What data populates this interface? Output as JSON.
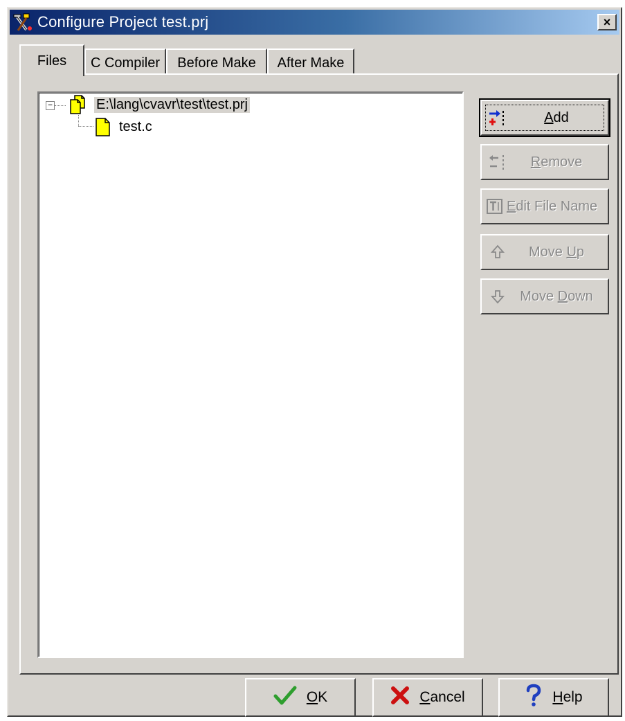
{
  "window": {
    "title": "Configure Project test.prj",
    "close_label": "×"
  },
  "tabs": [
    {
      "label": "Files",
      "active": true
    },
    {
      "label": "C Compiler",
      "active": false
    },
    {
      "label": "Before Make",
      "active": false
    },
    {
      "label": "After Make",
      "active": false
    }
  ],
  "tree": {
    "expand_symbol": "−",
    "root": {
      "label": "E:\\lang\\cvavr\\test\\test.prj",
      "expanded": true,
      "selected": true
    },
    "children": [
      {
        "label": "test.c"
      }
    ]
  },
  "side_buttons": {
    "add": {
      "mnemonic": "A",
      "rest": "dd",
      "enabled": true
    },
    "remove": {
      "mnemonic": "R",
      "rest": "emove",
      "enabled": false
    },
    "edit": {
      "pre": "",
      "mnemonic": "E",
      "rest": "dit File Name",
      "enabled": false
    },
    "move_up": {
      "pre": "Move ",
      "mnemonic": "U",
      "rest": "p",
      "enabled": false
    },
    "move_down": {
      "pre": "Move ",
      "mnemonic": "D",
      "rest": "own",
      "enabled": false
    }
  },
  "bottom_buttons": {
    "ok": {
      "mnemonic": "O",
      "rest": "K"
    },
    "cancel": {
      "mnemonic": "C",
      "rest": "ancel"
    },
    "help": {
      "mnemonic": "H",
      "rest": "elp"
    }
  },
  "colors": {
    "titlebar_start": "#0a246a",
    "titlebar_end": "#a6caf0",
    "face": "#d6d3ce",
    "ok_check": "#2e9e2e",
    "cancel_x": "#cc1010",
    "help_q": "#1f3fbf",
    "file_icon": "#ffff00"
  },
  "icons": {
    "title": "project-tools-icon",
    "root": "project-files-icon",
    "child": "c-file-icon",
    "add": "add-file-icon",
    "remove": "remove-file-icon",
    "edit": "rename-icon",
    "move_up": "arrow-up-icon",
    "move_down": "arrow-down-icon",
    "ok": "checkmark-icon",
    "cancel": "x-icon",
    "help": "question-icon"
  }
}
